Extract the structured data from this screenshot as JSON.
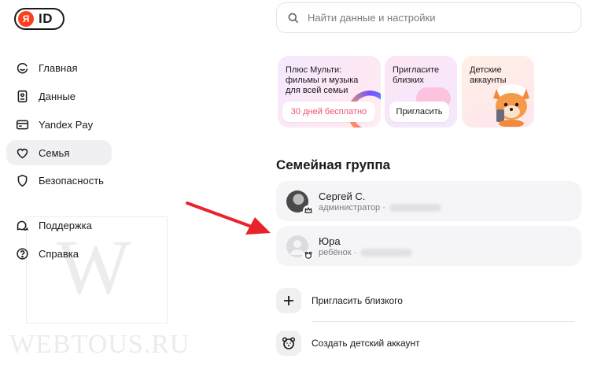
{
  "logo": {
    "badge": "Я",
    "text": "ID"
  },
  "search": {
    "placeholder": "Найти данные и настройки"
  },
  "sidebar": {
    "items": [
      {
        "label": "Главная",
        "icon": "home-smile-icon",
        "active": false
      },
      {
        "label": "Данные",
        "icon": "id-card-icon",
        "active": false
      },
      {
        "label": "Yandex Pay",
        "icon": "credit-card-icon",
        "active": false
      },
      {
        "label": "Семья",
        "icon": "heart-icon",
        "active": true
      },
      {
        "label": "Безопасность",
        "icon": "shield-icon",
        "active": false
      },
      {
        "label": "Поддержка",
        "icon": "chat-bubbles-icon",
        "active": false
      },
      {
        "label": "Справка",
        "icon": "question-circle-icon",
        "active": false
      }
    ]
  },
  "promo": {
    "plus": {
      "text": "Плюс Мульти:\nфильмы и музыка\nдля всей семьи",
      "button": "30 дней бесплатно"
    },
    "invite": {
      "text": "Пригласите\nблизких",
      "button": "Пригласить"
    },
    "kids": {
      "text": "Детские\nаккаунты"
    }
  },
  "family": {
    "title": "Семейная группа",
    "members": [
      {
        "name": "Сергей С.",
        "role": "администратор ·",
        "avatar": "photo",
        "role_icon": "crown-icon"
      },
      {
        "name": "Юра",
        "role": "ребёнок ·",
        "avatar": "placeholder",
        "role_icon": "bear-face-icon"
      }
    ],
    "actions": [
      {
        "label": "Пригласить близкого",
        "icon": "plus-icon"
      },
      {
        "label": "Создать детский аккаунт",
        "icon": "bear-face-icon"
      }
    ]
  },
  "watermark": {
    "letter": "W",
    "text": "WEBTOUS.RU"
  },
  "colors": {
    "accent": "#fc3f1d",
    "annotation_arrow": "#e8232b",
    "active_bg": "#f0f0f3",
    "plus_button_text": "#f0506e"
  }
}
